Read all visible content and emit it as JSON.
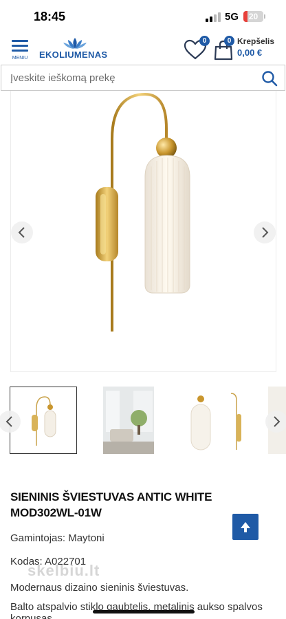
{
  "status_bar": {
    "time": "18:45",
    "network": "5G",
    "battery": "20",
    "battery_level": 0.2,
    "battery_color": "#e8403a"
  },
  "header": {
    "menu_label": "MENIU",
    "logo_text": "EKOLIUMENAS",
    "wishlist_count": "0",
    "cart_count": "0",
    "cart_label": "Krepšelis",
    "cart_total": "0,00 €",
    "brand_color": "#1f5aa6"
  },
  "search": {
    "placeholder": "Įveskite ieškomą prekę"
  },
  "product": {
    "title": "SIENINIS ŠVIESTUVAS ANTIC WHITE MOD302WL-01W",
    "manufacturer": "Gamintojas: Maytoni",
    "code": "Kodas: A022701",
    "description_1": "Modernaus dizaino sieninis šviestuvas.",
    "description_2": "Balto atspalvio stiklo gaubtelis, metalinis aukso spalvos",
    "description_3": "korpusas."
  },
  "watermark": "skelbiu.lt",
  "icons": {
    "menu": "hamburger-icon",
    "wishlist": "heart-icon",
    "cart": "shopping-bag-icon",
    "search": "search-icon",
    "prev": "chevron-left-icon",
    "next": "chevron-right-icon",
    "scroll_top": "arrow-up-icon"
  }
}
